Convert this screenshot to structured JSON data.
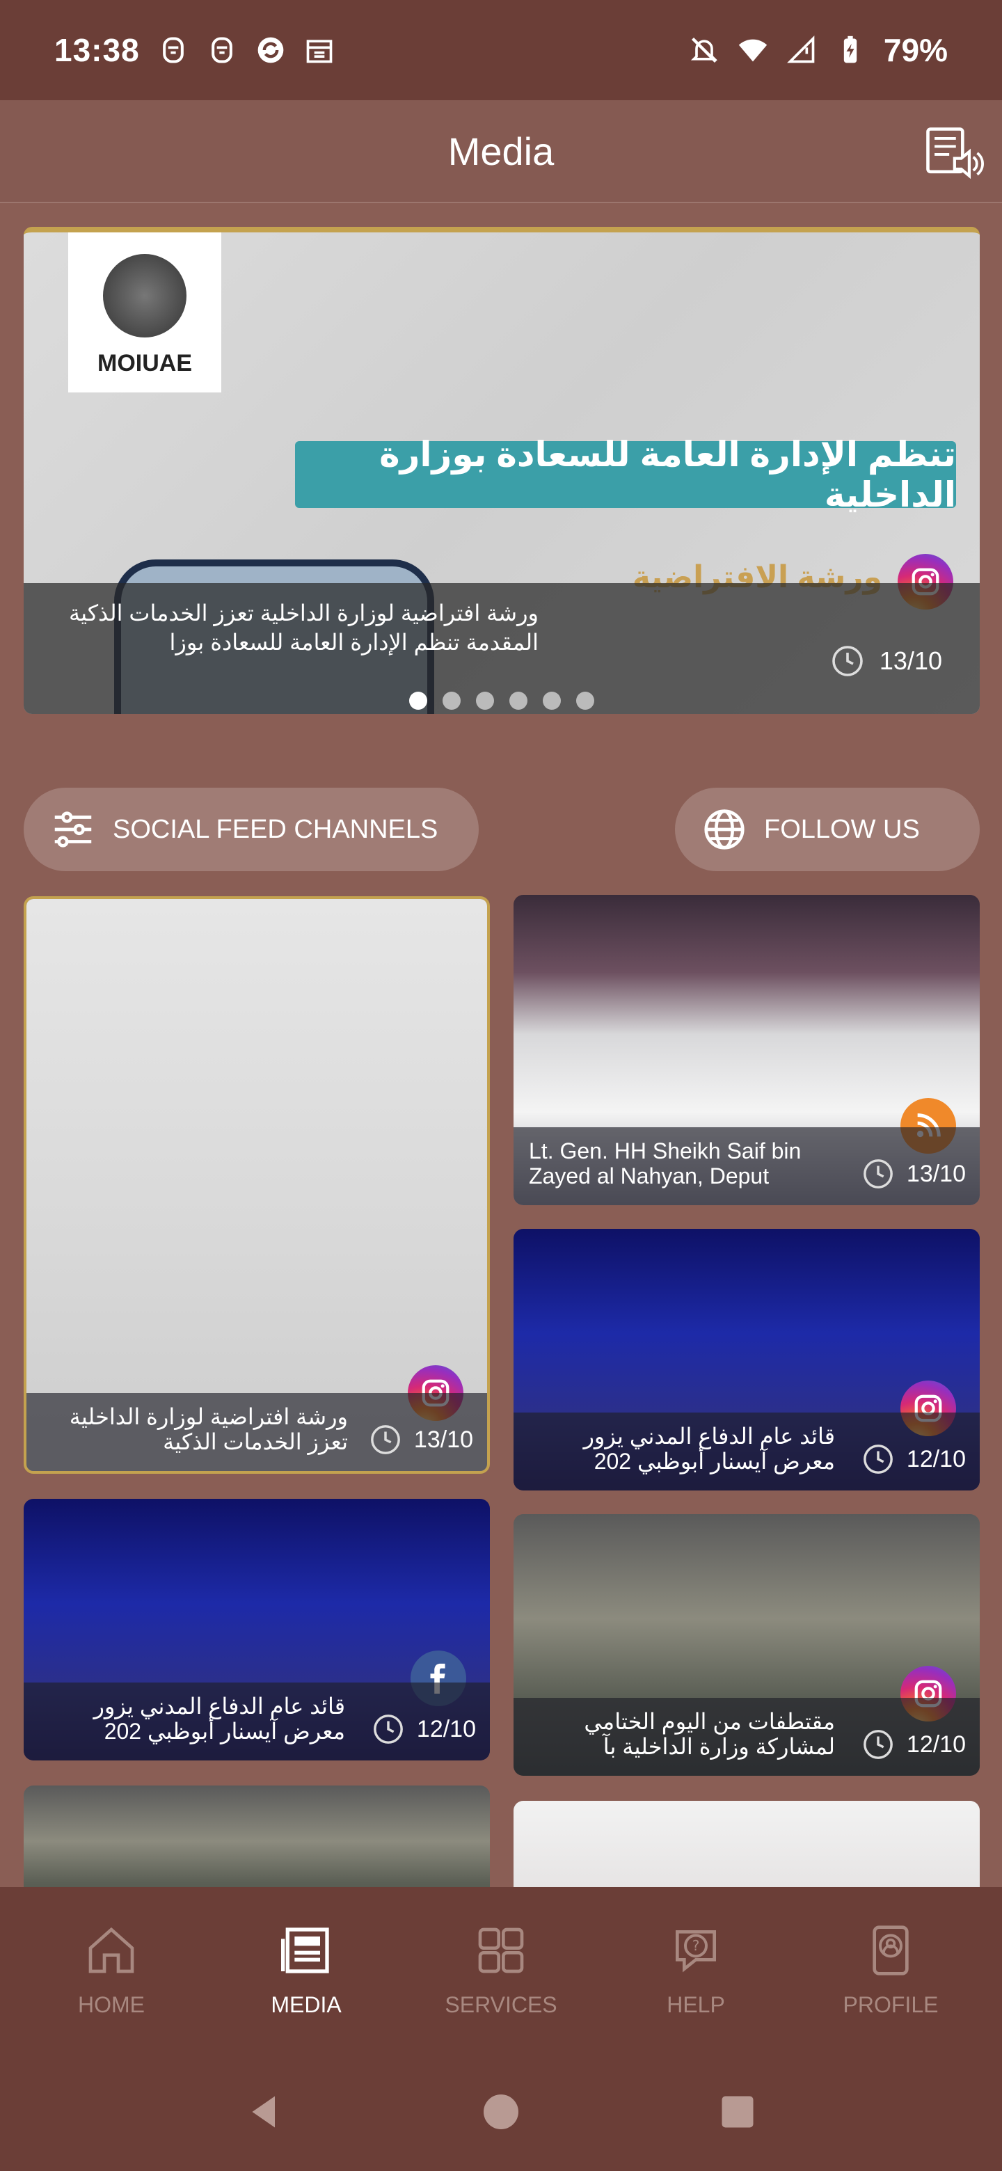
{
  "status_bar": {
    "time": "13:38",
    "battery": "79%",
    "left_icons": [
      "app-icon",
      "app-icon",
      "media-icon",
      "calendar-icon"
    ],
    "right_icons": [
      "mute-icon",
      "wifi-icon",
      "signal-icon",
      "battery-icon"
    ]
  },
  "app_bar": {
    "title": "Media",
    "action_icon": "media-speaker-icon"
  },
  "hero": {
    "logo_text": "MOIUAE",
    "ribbon_text": "تنظم الإدارة العامة للسعادة بوزارة الداخلية",
    "subtitle": "ورشة الافتراضية",
    "caption": "ورشة افتراضية لوزارة الداخلية تعزز الخدمات الذكية المقدمة تنظم الإدارة العامة للسعادة بوزا",
    "date": "13/10",
    "source": "instagram",
    "page_count": 6,
    "active_page": 0
  },
  "actions": {
    "social_feed_label": "SOCIAL FEED CHANNELS",
    "follow_label": "FOLLOW US"
  },
  "cards": [
    {
      "caption": "ورشة افتراضية لوزارة الداخلية تعزز الخدمات الذكية",
      "date": "13/10",
      "source": "instagram"
    },
    {
      "caption": "Lt. Gen. HH Sheikh Saif bin Zayed al Nahyan, Deput",
      "date": "13/10",
      "source": "rss"
    },
    {
      "caption": "قائد عام الدفاع المدني يزور معرض آيسنار أبوظبي 202",
      "date": "12/10",
      "source": "instagram"
    },
    {
      "caption": "قائد عام الدفاع المدني يزور معرض آيسنار أبوظبي 202",
      "date": "12/10",
      "source": "facebook"
    },
    {
      "caption": "مقتطفات من اليوم الختامي لمشاركة وزارة الداخلية بآ",
      "date": "12/10",
      "source": "instagram"
    }
  ],
  "bottom_nav": {
    "items": [
      {
        "label": "HOME",
        "icon": "home-icon"
      },
      {
        "label": "MEDIA",
        "icon": "newspaper-icon"
      },
      {
        "label": "SERVICES",
        "icon": "grid-icon"
      },
      {
        "label": "HELP",
        "icon": "help-chat-icon"
      },
      {
        "label": "PROFILE",
        "icon": "profile-icon"
      }
    ],
    "active": "MEDIA"
  }
}
